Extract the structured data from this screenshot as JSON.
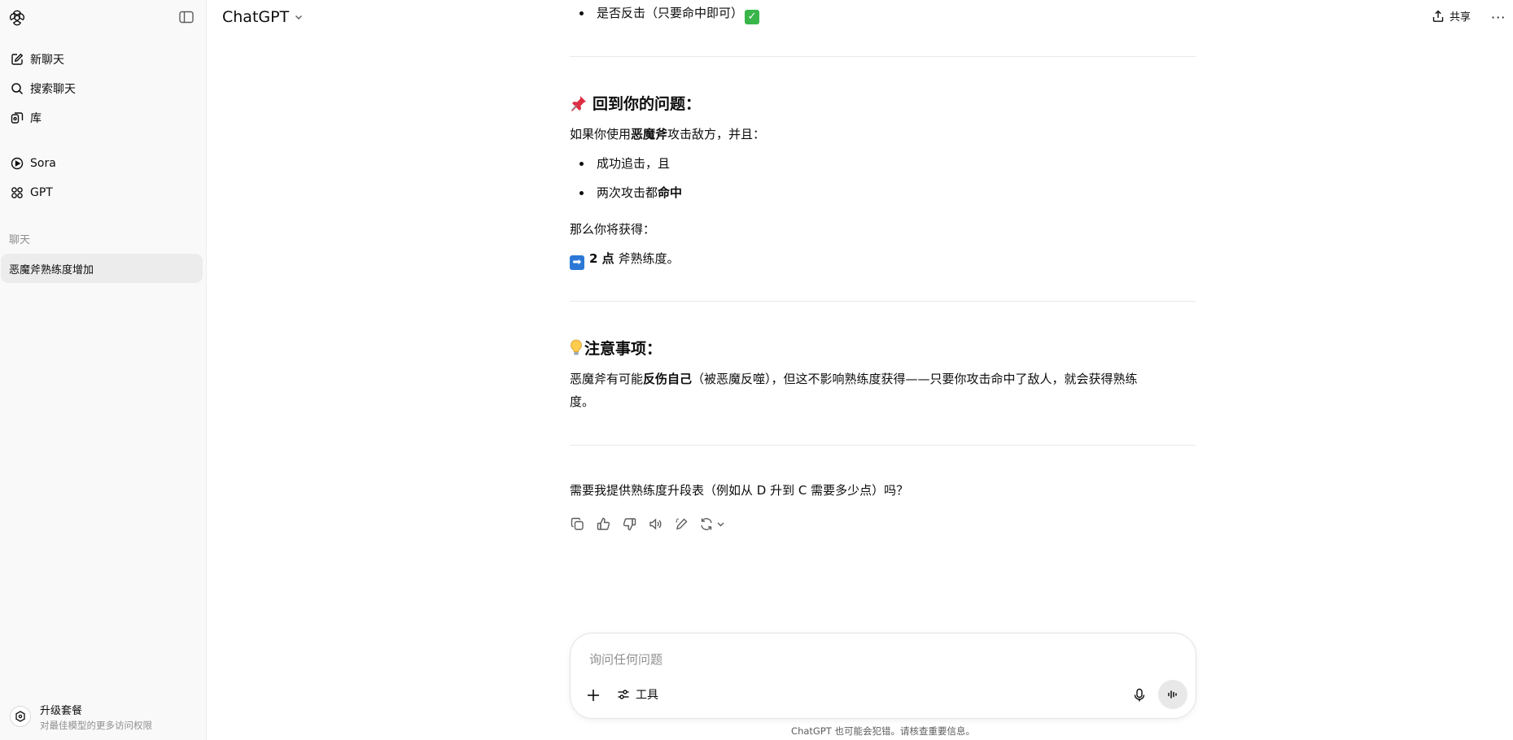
{
  "sidebar": {
    "items": [
      {
        "label": "新聊天",
        "icon": "edit-icon"
      },
      {
        "label": "搜索聊天",
        "icon": "search-icon"
      },
      {
        "label": "库",
        "icon": "library-icon"
      },
      {
        "label": "Sora",
        "icon": "play-circle-icon"
      },
      {
        "label": "GPT",
        "icon": "grid-icon"
      }
    ],
    "section_title": "聊天",
    "chats": [
      {
        "title": "恶魔斧熟练度增加"
      }
    ],
    "upgrade": {
      "title": "升级套餐",
      "subtitle": "对最佳模型的更多访问权限"
    }
  },
  "header": {
    "model": "ChatGPT",
    "share_label": "共享",
    "more": "···"
  },
  "message": {
    "top_bullet": "是否反击（只要命中即可）",
    "section1_title": "回到你的问题：",
    "intro_pre": "如果你使用",
    "intro_bold": "恶魔斧",
    "intro_post": "攻击敌方，并且：",
    "bullet1": "成功追击，且",
    "bullet2_pre": "两次攻击都",
    "bullet2_bold": "命中",
    "result_intro": "那么你将获得：",
    "result_bold": "2 点",
    "result_text": "斧熟练度。",
    "section2_title": "注意事项：",
    "note_pre": "恶魔斧有可能",
    "note_bold": "反伤自己",
    "note_line1_rest": "（被恶魔反噬），但这不影响熟练度获得——只要你攻击命中了敌人，就会获得熟练",
    "note_line2": "度。",
    "followup": "需要我提供熟练度升段表（例如从 D 升到 C 需要多少点）吗？"
  },
  "composer": {
    "placeholder": "询问任何问题",
    "tools_label": "工具"
  },
  "disclaimer": "ChatGPT 也可能会犯错。请核查重要信息。",
  "colors": {
    "sidebar_bg": "#f9f9f9",
    "selected_chat": "#ececec",
    "check_green": "#39b54a",
    "arrow_blue": "#2b78d6"
  }
}
